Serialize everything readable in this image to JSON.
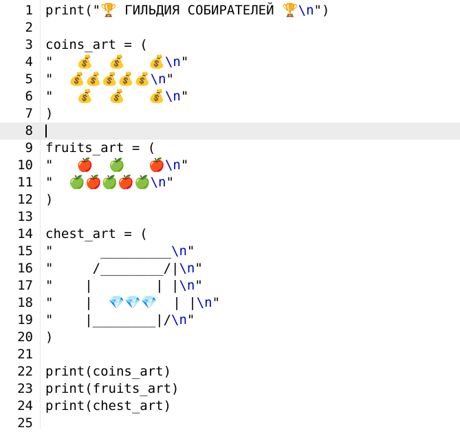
{
  "editor": {
    "current_line": 8,
    "lines": [
      {
        "n": "1",
        "tokens": [
          [
            "print(\"",
            "plain"
          ],
          [
            "🏆 ГИЛЬДИЯ СОБИРАТЕЛЕЙ 🏆",
            "plain"
          ],
          [
            "\\n",
            "esc"
          ],
          [
            "\")",
            "plain"
          ]
        ]
      },
      {
        "n": "2",
        "tokens": []
      },
      {
        "n": "3",
        "tokens": [
          [
            "coins_art = (",
            "plain"
          ]
        ]
      },
      {
        "n": "4",
        "tokens": [
          [
            "\"   💰  💰   💰",
            "plain"
          ],
          [
            "\\n",
            "esc"
          ],
          [
            "\"",
            "plain"
          ]
        ]
      },
      {
        "n": "5",
        "tokens": [
          [
            "\"  💰💰💰💰💰",
            "plain"
          ],
          [
            "\\n",
            "esc"
          ],
          [
            "\"",
            "plain"
          ]
        ]
      },
      {
        "n": "6",
        "tokens": [
          [
            "\"   💰  💰   💰",
            "plain"
          ],
          [
            "\\n",
            "esc"
          ],
          [
            "\"",
            "plain"
          ]
        ]
      },
      {
        "n": "7",
        "tokens": [
          [
            ")",
            "plain"
          ]
        ]
      },
      {
        "n": "8",
        "tokens": []
      },
      {
        "n": "9",
        "tokens": [
          [
            "fruits_art = (",
            "plain"
          ]
        ]
      },
      {
        "n": "10",
        "tokens": [
          [
            "\"   🍎  🍏   🍎",
            "plain"
          ],
          [
            "\\n",
            "esc"
          ],
          [
            "\"",
            "plain"
          ]
        ]
      },
      {
        "n": "11",
        "tokens": [
          [
            "\"  🍏🍎🍏🍎🍏",
            "plain"
          ],
          [
            "\\n",
            "esc"
          ],
          [
            "\"",
            "plain"
          ]
        ]
      },
      {
        "n": "12",
        "tokens": [
          [
            ")",
            "plain"
          ]
        ]
      },
      {
        "n": "13",
        "tokens": []
      },
      {
        "n": "14",
        "tokens": [
          [
            "chest_art = (",
            "plain"
          ]
        ]
      },
      {
        "n": "15",
        "tokens": [
          [
            "\"      _________",
            "plain"
          ],
          [
            "\\n",
            "esc"
          ],
          [
            "\"",
            "plain"
          ]
        ]
      },
      {
        "n": "16",
        "tokens": [
          [
            "\"     /________/|",
            "plain"
          ],
          [
            "\\n",
            "esc"
          ],
          [
            "\"",
            "plain"
          ]
        ]
      },
      {
        "n": "17",
        "tokens": [
          [
            "\"    |        | |",
            "plain"
          ],
          [
            "\\n",
            "esc"
          ],
          [
            "\"",
            "plain"
          ]
        ]
      },
      {
        "n": "18",
        "tokens": [
          [
            "\"    |  💎💎💎  | |",
            "plain"
          ],
          [
            "\\n",
            "esc"
          ],
          [
            "\"",
            "plain"
          ]
        ]
      },
      {
        "n": "19",
        "tokens": [
          [
            "\"    |________|/",
            "plain"
          ],
          [
            "\\n",
            "esc"
          ],
          [
            "\"",
            "plain"
          ]
        ]
      },
      {
        "n": "20",
        "tokens": [
          [
            ")",
            "plain"
          ]
        ]
      },
      {
        "n": "21",
        "tokens": []
      },
      {
        "n": "22",
        "tokens": [
          [
            "print(coins_art)",
            "plain"
          ]
        ]
      },
      {
        "n": "23",
        "tokens": [
          [
            "print(fruits_art)",
            "plain"
          ]
        ]
      },
      {
        "n": "24",
        "tokens": [
          [
            "print(chest_art)",
            "plain"
          ]
        ]
      },
      {
        "n": "25",
        "tokens": []
      }
    ]
  }
}
